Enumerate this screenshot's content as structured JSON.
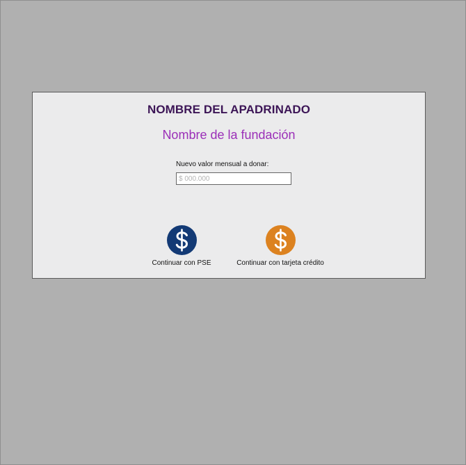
{
  "modal": {
    "sponsored_name": "NOMBRE DEL APADRINADO",
    "foundation_name": "Nombre de la fundación",
    "amount": {
      "label": "Nuevo valor mensual a donar:",
      "placeholder": "$ 000.000",
      "value": ""
    },
    "payment_options": [
      {
        "label": "Continuar con PSE",
        "icon": "dollar-icon",
        "color": "#133a75"
      },
      {
        "label": "Continuar con tarjeta crédito",
        "icon": "dollar-icon",
        "color": "#dc8220"
      }
    ]
  },
  "colors": {
    "backdrop": "#b0b0b0",
    "modal_background": "#ebebec",
    "title": "#3c1556",
    "subtitle": "#9b2fb8"
  }
}
